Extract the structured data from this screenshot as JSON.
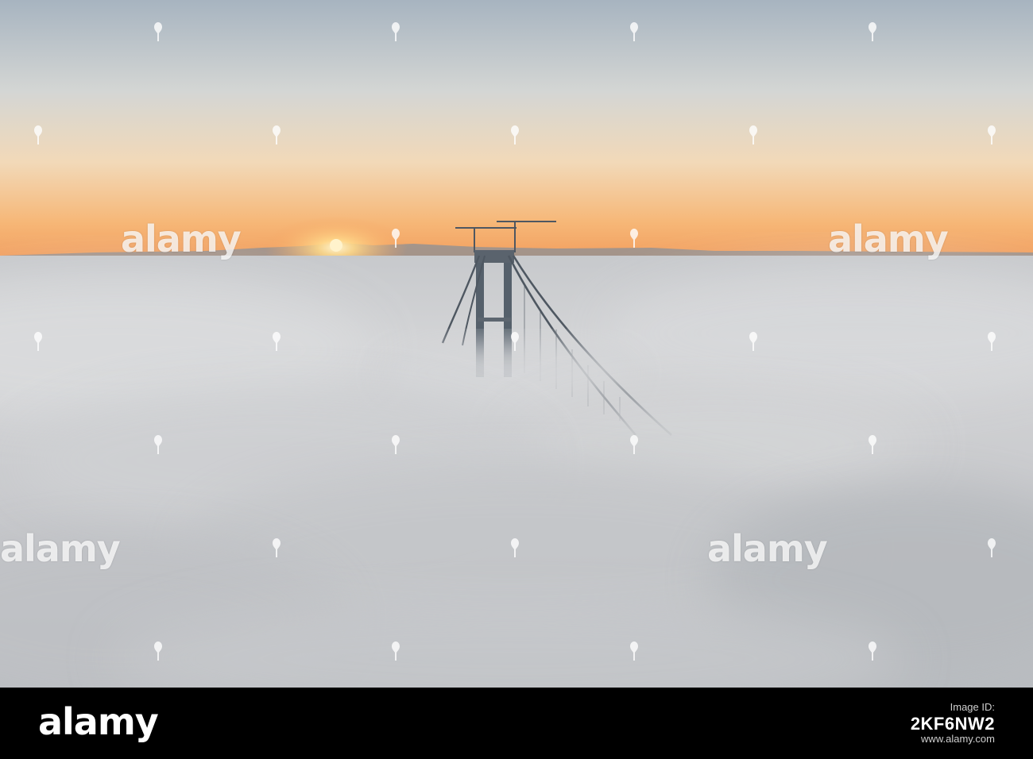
{
  "watermark": {
    "text": "alamy"
  },
  "footer": {
    "logo": "alamy",
    "label": "Image ID:",
    "image_id": "2KF6NW2",
    "site": "www.alamy.com"
  },
  "colors": {
    "sky_top": "#a9b5c0",
    "sky_mid": "#e3e0d8",
    "horizon": "#f4a865",
    "sun": "#ffe0a0",
    "fog": "#cfd0d2",
    "bridge": "#4f5863"
  }
}
